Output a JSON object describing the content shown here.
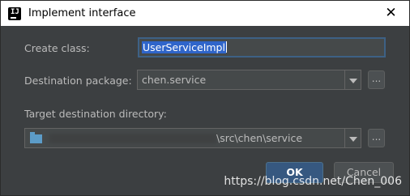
{
  "window": {
    "title": "Implement interface",
    "close_glyph": "✕",
    "app_icon": "intellij-icon",
    "app_icon_glyph": "IJ"
  },
  "form": {
    "create_class_label": "Create class:",
    "create_class_value": "UserServiceImpl",
    "destination_package_label": "Destination package:",
    "destination_package_value": "chen.service",
    "target_directory_label": "Target destination directory:",
    "target_directory_value": "\\src\\chen\\service",
    "browse_label": "..."
  },
  "buttons": {
    "ok": "OK",
    "cancel": "Cancel"
  },
  "watermark": "https://blog.csdn.net/Chen_006",
  "colors": {
    "background": "#3c3f41",
    "field": "#45494a",
    "selection": "#2f65ca",
    "ok_button": "#365880",
    "folder_icon": "#5c9cc8"
  }
}
